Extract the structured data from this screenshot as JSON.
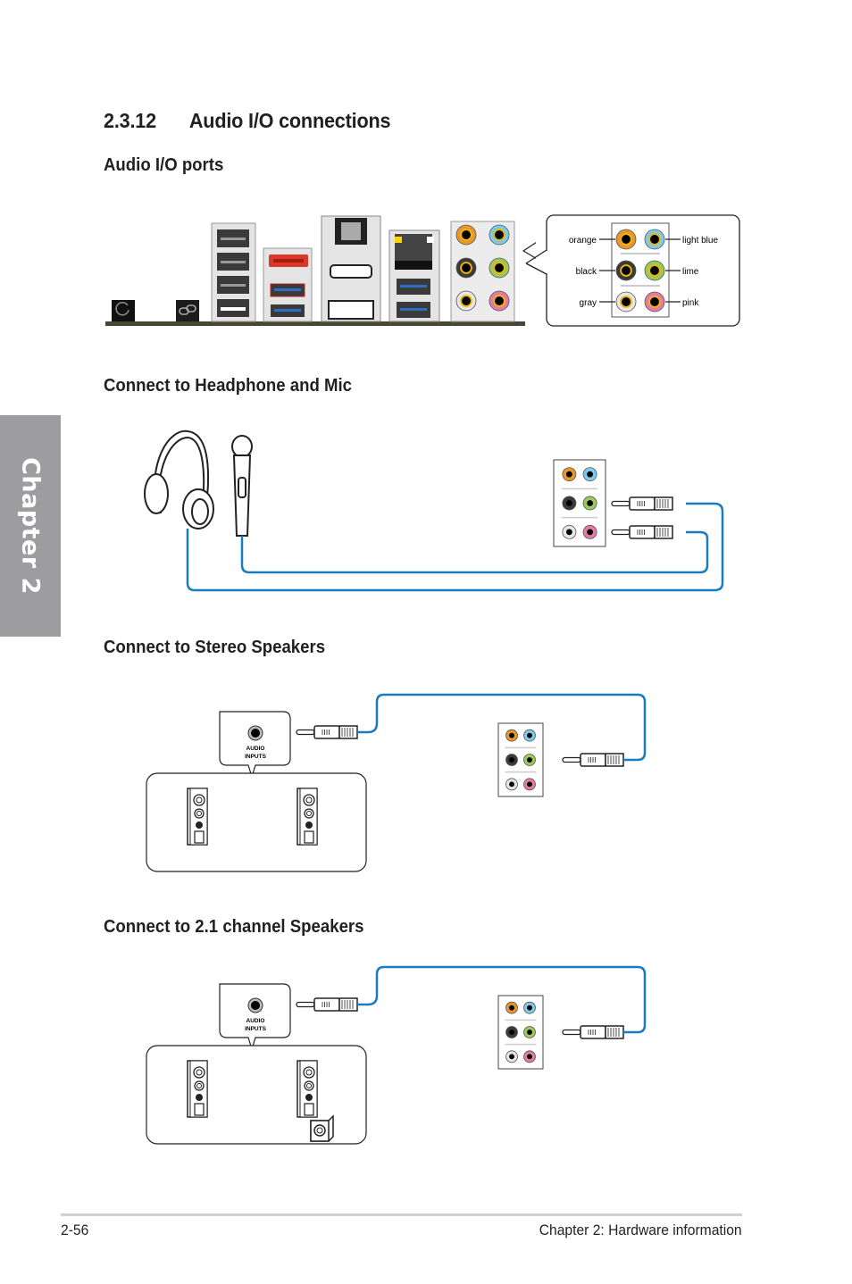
{
  "chapter_tab": "Chapter 2",
  "section": {
    "number": "2.3.12",
    "title": "Audio I/O connections"
  },
  "subsections": {
    "ports": "Audio I/O ports",
    "headphone_mic": "Connect to Headphone and Mic",
    "stereo": "Connect to Stereo Speakers",
    "two_one": "Connect to 2.1 channel Speakers"
  },
  "port_legend": {
    "left": [
      "orange",
      "black",
      "gray"
    ],
    "right": [
      "light blue",
      "lime",
      "pink"
    ]
  },
  "jack_colors": {
    "orange": "#e8962e",
    "light_blue": "#7ccbea",
    "black": "#3a3a3a",
    "lime": "#9bc95a",
    "gray": "#e6e6e6",
    "pink": "#e67aa6"
  },
  "cable_color": "#1a7bbf",
  "audio_inputs_label": [
    "AUDIO",
    "INPUTS"
  ],
  "footer": {
    "page": "2-56",
    "chapter": "Chapter 2: Hardware information"
  }
}
